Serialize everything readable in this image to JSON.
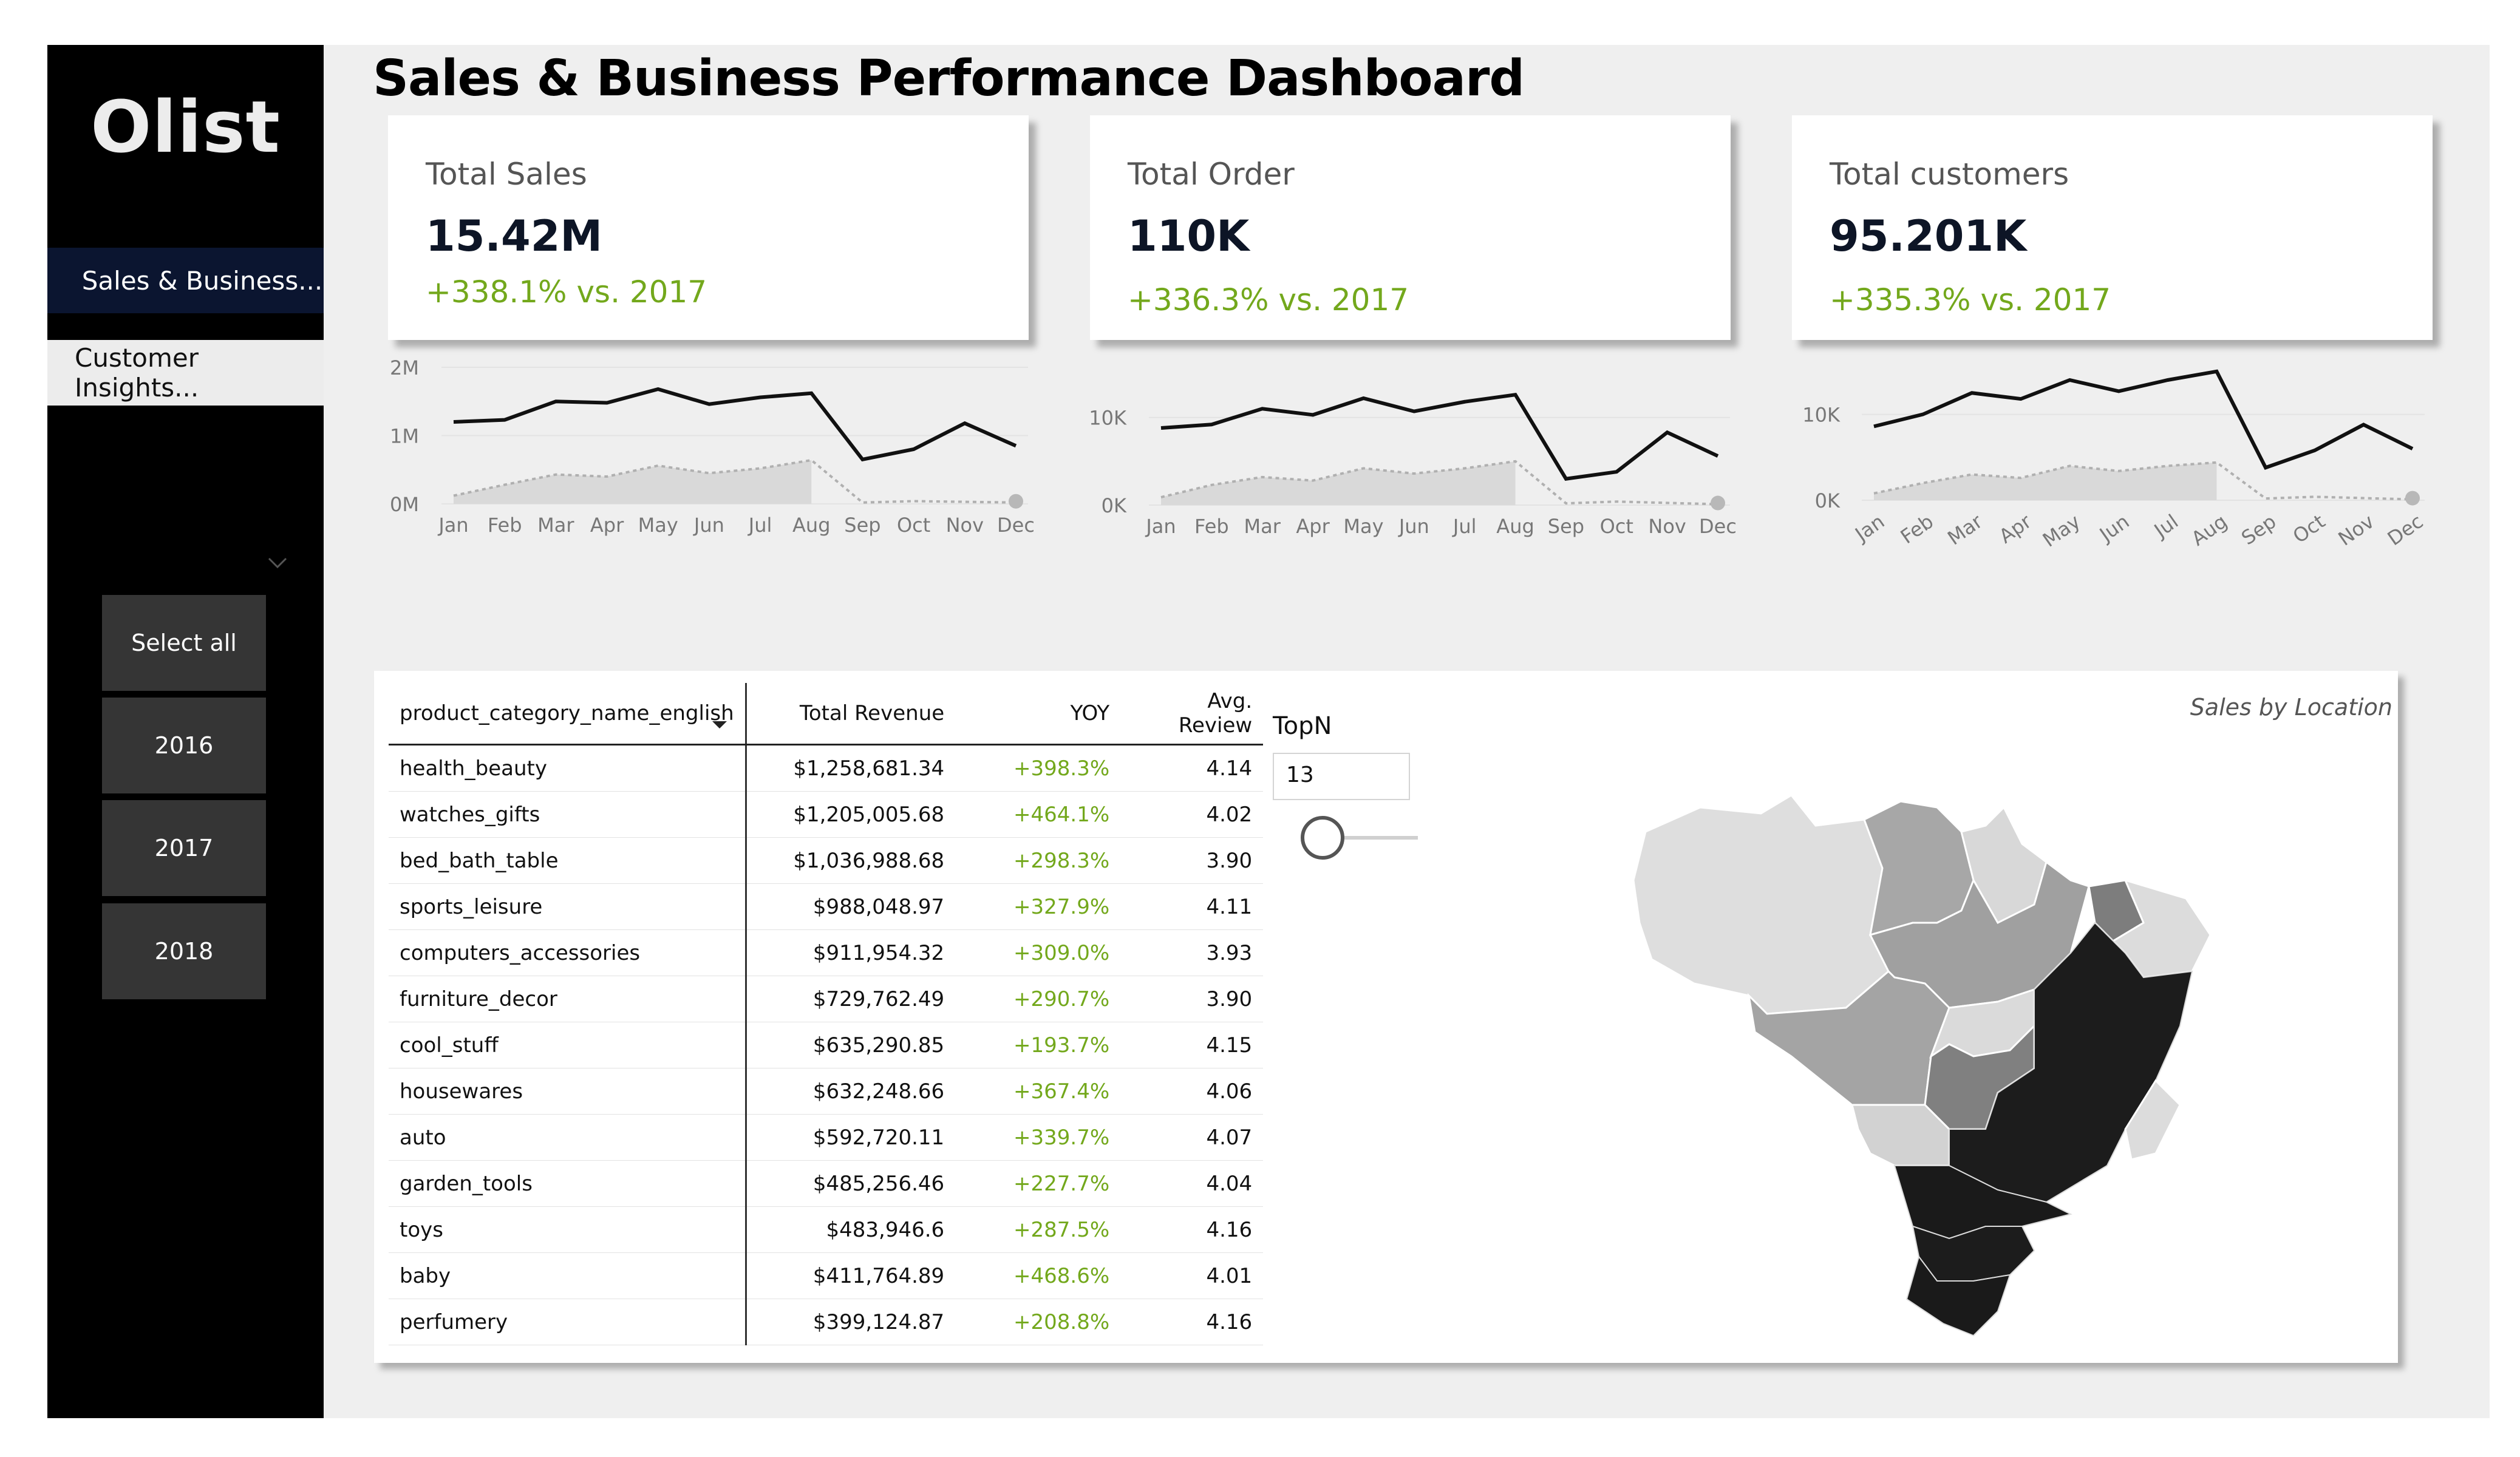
{
  "app": {
    "logo": "Olist",
    "title": "Sales & Business Performance Dashboard"
  },
  "sidebar": {
    "nav": [
      {
        "label": "Sales & Business...",
        "active": true
      },
      {
        "label": "Customer Insights...",
        "active": false
      }
    ],
    "dropdown_icon": "chevron-down-icon",
    "slicers": [
      "Select all",
      "2016",
      "2017",
      "2018"
    ]
  },
  "colors": {
    "accent_green": "#73a81c",
    "nav_active": "#0b1530",
    "sidebar": "#000000",
    "canvas": "#efefef"
  },
  "kpis": [
    {
      "label": "Total Sales",
      "value": "15.42M",
      "change": "+338.1% vs. 2017"
    },
    {
      "label": "Total Order",
      "value": "110K",
      "change": "+336.3% vs. 2017"
    },
    {
      "label": "Total customers",
      "value": "95.201K",
      "change": "+335.3% vs. 2017"
    }
  ],
  "chart_data": [
    {
      "type": "line",
      "x": [
        "Jan",
        "Feb",
        "Mar",
        "Apr",
        "May",
        "Jun",
        "Jul",
        "Aug",
        "Sep",
        "Oct",
        "Nov",
        "Dec"
      ],
      "yticks": [
        "0M",
        "1M",
        "2M"
      ],
      "ylim": [
        0,
        2000000
      ],
      "series": [
        {
          "values": [
            1200000,
            1230000,
            1500000,
            1480000,
            1680000,
            1460000,
            1560000,
            1620000,
            650000,
            800000,
            1180000,
            850000
          ]
        },
        {
          "values": [
            120000,
            280000,
            430000,
            400000,
            560000,
            450000,
            520000,
            640000,
            20000,
            40000,
            null,
            20000
          ]
        }
      ]
    },
    {
      "type": "line",
      "x": [
        "Jan",
        "Feb",
        "Mar",
        "Apr",
        "May",
        "Jun",
        "Jul",
        "Aug",
        "Sep",
        "Oct",
        "Nov",
        "Dec"
      ],
      "yticks": [
        "0K",
        "10K"
      ],
      "ylim": [
        0,
        14000
      ],
      "series": [
        {
          "values": [
            8800,
            9200,
            11000,
            10300,
            12200,
            10700,
            11800,
            12600,
            3000,
            3800,
            8300,
            5600
          ]
        },
        {
          "values": [
            900,
            2300,
            3200,
            2800,
            4200,
            3600,
            4200,
            5000,
            200,
            400,
            null,
            100
          ]
        }
      ]
    },
    {
      "type": "line",
      "x": [
        "Jan",
        "Feb",
        "Mar",
        "Apr",
        "May",
        "Jun",
        "Jul",
        "Aug",
        "Sep",
        "Oct",
        "Nov",
        "Dec"
      ],
      "yticks": [
        "0K",
        "10K"
      ],
      "ylim": [
        0,
        14000
      ],
      "series": [
        {
          "values": [
            8600,
            10000,
            12500,
            11800,
            14000,
            12700,
            14000,
            15000,
            3800,
            5800,
            8800,
            6000
          ]
        },
        {
          "values": [
            800,
            2000,
            3000,
            2600,
            4000,
            3400,
            4000,
            4400,
            200,
            400,
            null,
            100
          ]
        }
      ]
    }
  ],
  "table": {
    "headers": [
      "product_category_name_english",
      "Total Revenue",
      "YOY",
      "Avg. Review"
    ],
    "rows": [
      [
        "health_beauty",
        "$1,258,681.34",
        "+398.3%",
        "4.14"
      ],
      [
        "watches_gifts",
        "$1,205,005.68",
        "+464.1%",
        "4.02"
      ],
      [
        "bed_bath_table",
        "$1,036,988.68",
        "+298.3%",
        "3.90"
      ],
      [
        "sports_leisure",
        "$988,048.97",
        "+327.9%",
        "4.11"
      ],
      [
        "computers_accessories",
        "$911,954.32",
        "+309.0%",
        "3.93"
      ],
      [
        "furniture_decor",
        "$729,762.49",
        "+290.7%",
        "3.90"
      ],
      [
        "cool_stuff",
        "$635,290.85",
        "+193.7%",
        "4.15"
      ],
      [
        "housewares",
        "$632,248.66",
        "+367.4%",
        "4.06"
      ],
      [
        "auto",
        "$592,720.11",
        "+339.7%",
        "4.07"
      ],
      [
        "garden_tools",
        "$485,256.46",
        "+227.7%",
        "4.04"
      ],
      [
        "toys",
        "$483,946.6",
        "+287.5%",
        "4.16"
      ],
      [
        "baby",
        "$411,764.89",
        "+468.6%",
        "4.01"
      ],
      [
        "perfumery",
        "$399,124.87",
        "+208.8%",
        "4.16"
      ]
    ]
  },
  "topn": {
    "label": "TopN",
    "value": "13",
    "slider_level": 0.1
  },
  "map": {
    "title": "Sales by Location"
  }
}
